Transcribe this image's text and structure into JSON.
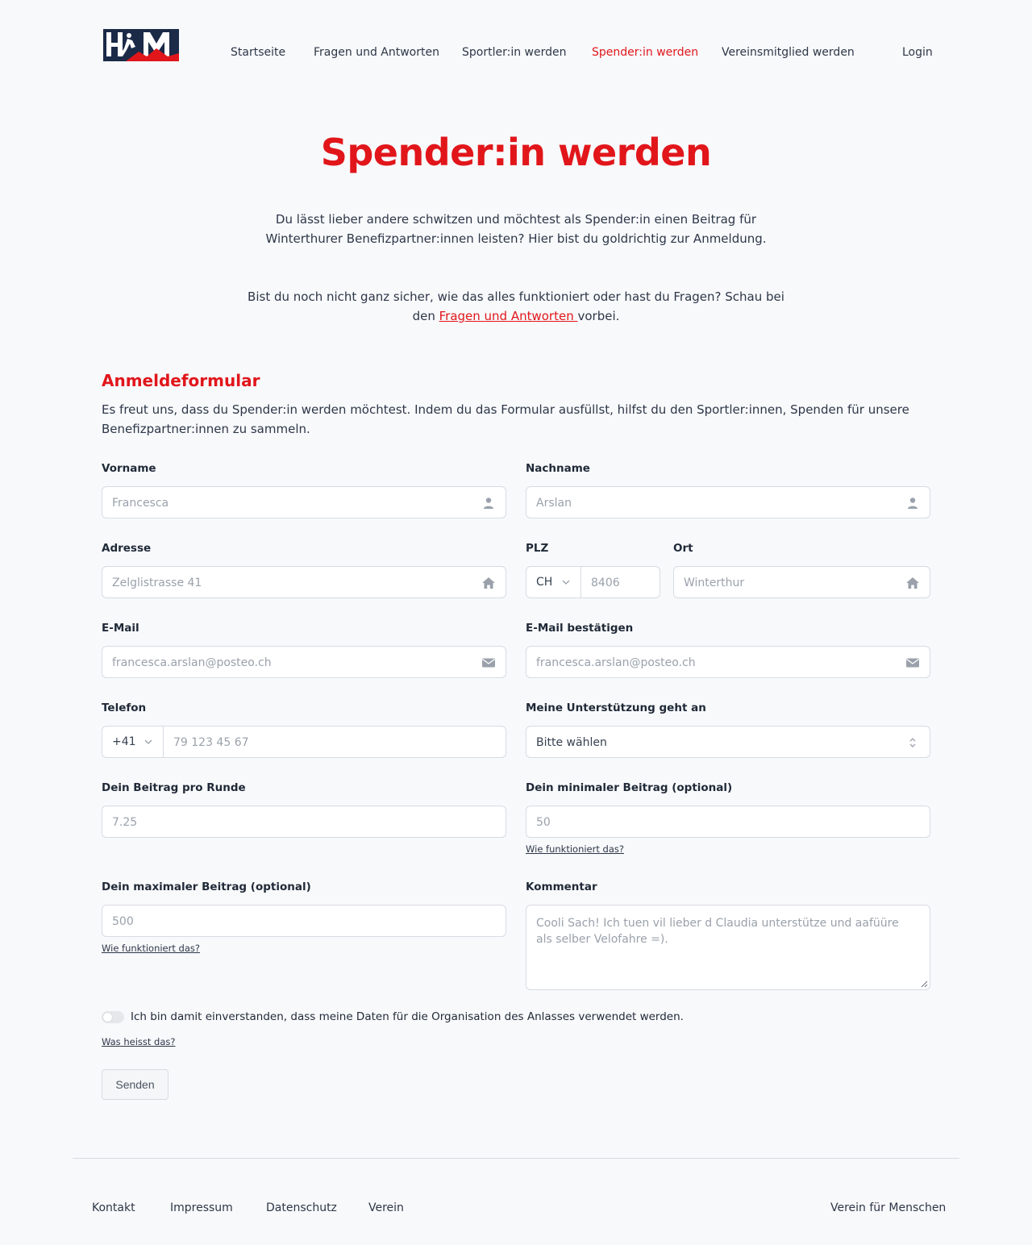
{
  "header": {
    "logo_text": "HFM",
    "nav": [
      {
        "label": "Startseite"
      },
      {
        "label": "Fragen und Antworten"
      },
      {
        "label": "Sportler:in werden"
      },
      {
        "label": "Spender:in werden",
        "active": true
      },
      {
        "label": "Vereinsmitglied werden"
      }
    ],
    "login": "Login"
  },
  "hero": {
    "title": "Spender:in werden",
    "intro_line1": "Du lässt lieber andere schwitzen und möchtest als Spender:in einen Beitrag für",
    "intro_line2": "Winterthurer Benefizpartner:innen leisten? Hier bist du goldrichtig zur Anmeldung.",
    "faq_line1": "Bist du noch nicht ganz sicher, wie das alles funktioniert oder hast du Fragen? Schau bei",
    "faq_pre": "den ",
    "faq_link": "Fragen und Antworten ",
    "faq_post": "vorbei."
  },
  "form": {
    "title": "Anmeldeformular",
    "intro": "Es freut uns, dass du Spender:in werden möchtest. Indem du das Formular ausfüllst, hilfst du den Sportler:innen, Spenden für unsere Benefizpartner:innen zu sammeln.",
    "vorname": {
      "label": "Vorname",
      "placeholder": "Francesca"
    },
    "nachname": {
      "label": "Nachname",
      "placeholder": "Arslan"
    },
    "adresse": {
      "label": "Adresse",
      "placeholder": "Zelglistrasse 41"
    },
    "plz": {
      "label": "PLZ",
      "country": "CH",
      "placeholder": "8406"
    },
    "ort": {
      "label": "Ort",
      "placeholder": "Winterthur"
    },
    "email": {
      "label": "E-Mail",
      "placeholder": "francesca.arslan@posteo.ch"
    },
    "email_confirm": {
      "label": "E-Mail bestätigen",
      "placeholder": "francesca.arslan@posteo.ch"
    },
    "telefon": {
      "label": "Telefon",
      "prefix": "+41",
      "placeholder": "79 123 45 67"
    },
    "support": {
      "label": "Meine Unterstützung geht an",
      "value": "Bitte wählen"
    },
    "beitrag": {
      "label": "Dein Beitrag pro Runde",
      "placeholder": "7.25"
    },
    "min_beitrag": {
      "label": "Dein minimaler Beitrag (optional)",
      "placeholder": "50",
      "help": "Wie funktioniert das?"
    },
    "max_beitrag": {
      "label": "Dein maximaler Beitrag (optional)",
      "placeholder": "500",
      "help": "Wie funktioniert das?"
    },
    "kommentar": {
      "label": "Kommentar",
      "placeholder": "Cooli Sach! Ich tuen vil lieber d Claudia unterstütze und aafüüre als selber Velofahre =)."
    },
    "consent": {
      "text": "Ich bin damit einverstanden, dass meine Daten für die Organisation des Anlasses verwendet werden.",
      "help": "Was heisst das?",
      "checked": false
    },
    "submit": "Senden"
  },
  "footer": {
    "links": [
      "Kontakt",
      "Impressum",
      "Datenschutz",
      "Verein"
    ],
    "right": "Verein für Menschen"
  },
  "colors": {
    "accent": "#e1161b",
    "navy": "#1b2a47",
    "background": "#f8f9fb",
    "border": "#d7dbe2"
  }
}
